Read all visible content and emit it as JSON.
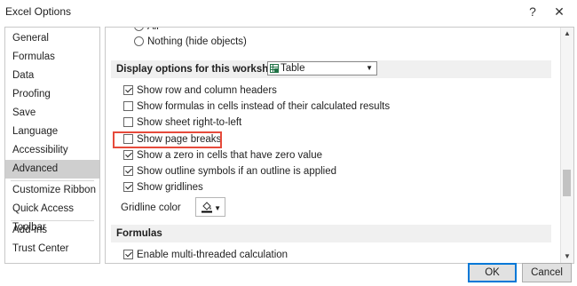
{
  "window": {
    "title": "Excel Options",
    "help_label": "?",
    "close_label": "✕"
  },
  "sidebar": {
    "items": [
      {
        "label": "General"
      },
      {
        "label": "Formulas"
      },
      {
        "label": "Data"
      },
      {
        "label": "Proofing"
      },
      {
        "label": "Save"
      },
      {
        "label": "Language"
      },
      {
        "label": "Accessibility"
      },
      {
        "label": "Advanced",
        "active": true
      },
      {
        "label": "Customize Ribbon"
      },
      {
        "label": "Quick Access Toolbar"
      },
      {
        "label": "Add-ins"
      },
      {
        "label": "Trust Center"
      }
    ]
  },
  "main": {
    "top_radio_partial": "All",
    "nothing_radio_label": "Nothing (hide objects)",
    "worksheet_section": {
      "title": "Display options for this worksheet:",
      "selected_sheet": "Table"
    },
    "options": [
      {
        "label": "Show row and column headers",
        "checked": true
      },
      {
        "label": "Show formulas in cells instead of their calculated results",
        "checked": false
      },
      {
        "label": "Show sheet right-to-left",
        "checked": false
      },
      {
        "label": "Show page breaks",
        "checked": false
      },
      {
        "label": "Show a zero in cells that have zero value",
        "checked": true
      },
      {
        "label": "Show outline symbols if an outline is applied",
        "checked": true
      },
      {
        "label": "Show gridlines",
        "checked": true
      }
    ],
    "gridline_color_label": "Gridline color",
    "formulas_section": {
      "title": "Formulas"
    },
    "multithread_option": {
      "label": "Enable multi-threaded calculation",
      "checked": true
    }
  },
  "footer": {
    "ok_label": "OK",
    "cancel_label": "Cancel"
  },
  "colors": {
    "highlight": "#e64a3b",
    "accent": "#0078d7",
    "active_nav": "#cfcfcf"
  }
}
